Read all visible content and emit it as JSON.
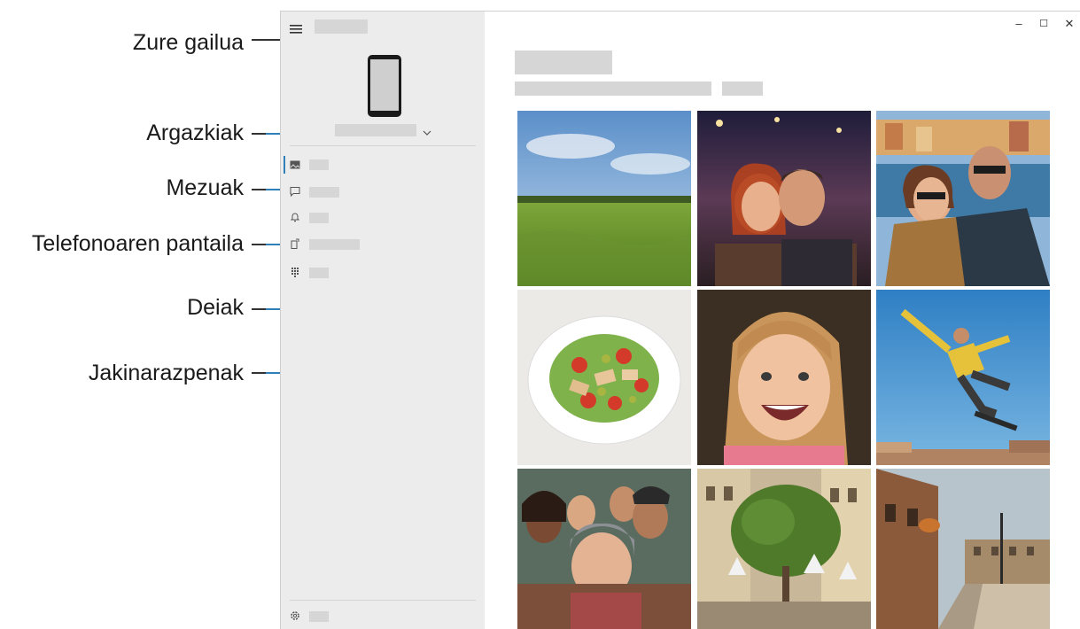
{
  "callouts": {
    "device": "Zure gailua",
    "photos": "Argazkiak",
    "messages": "Mezuak",
    "phone_screen": "Telefonoaren pantaila",
    "calls": "Deiak",
    "notifications": "Jakinarazpenak"
  },
  "window_controls": {
    "minimize": "–",
    "maximize": "☐",
    "close": "✕"
  },
  "photos": [
    {
      "subject": "grass-field-landscape"
    },
    {
      "subject": "couple-night-selfie"
    },
    {
      "subject": "couple-harbor-selfie"
    },
    {
      "subject": "salad-plate"
    },
    {
      "subject": "laughing-child"
    },
    {
      "subject": "skateboard-jump"
    },
    {
      "subject": "friends-group-selfie"
    },
    {
      "subject": "plaza-tree-umbrellas"
    },
    {
      "subject": "old-town-street"
    }
  ],
  "colors": {
    "accent": "#2f7fb8",
    "sidebar_bg": "#ececec",
    "placeholder": "#d6d6d6"
  }
}
